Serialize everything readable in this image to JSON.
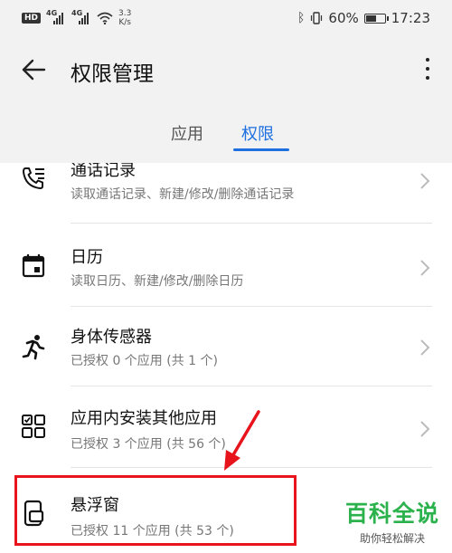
{
  "status_bar": {
    "hd_badge": "HD",
    "network_label_1": "4G",
    "network_label_2": "4G",
    "speed_value": "3.3",
    "speed_unit": "K/s",
    "battery_percent": "60%",
    "battery_level": 0.6,
    "time": "17:23"
  },
  "header": {
    "title": "权限管理"
  },
  "tabs": [
    {
      "label": "应用",
      "active": false
    },
    {
      "label": "权限",
      "active": true
    }
  ],
  "permissions": [
    {
      "title": "通话记录",
      "subtitle": "读取通话记录、新建/修改/删除通话记录",
      "icon": "call-log-icon"
    },
    {
      "title": "日历",
      "subtitle": "读取日历、新建/修改/删除日历",
      "icon": "calendar-icon"
    },
    {
      "title": "身体传感器",
      "subtitle": "已授权 0 个应用 (共 1 个)",
      "icon": "running-person-icon"
    },
    {
      "title": "应用内安装其他应用",
      "subtitle": "已授权 3 个应用 (共 56 个)",
      "icon": "app-grid-icon"
    },
    {
      "title": "悬浮窗",
      "subtitle": "已授权 11 个应用 (共 53 个)",
      "icon": "floating-window-icon"
    }
  ],
  "watermark": {
    "title": "百科全说",
    "subtitle": "助你轻松解决"
  },
  "colors": {
    "accent": "#1e6fe0",
    "highlight": "#e8141c",
    "watermark": "#2bb24c"
  }
}
